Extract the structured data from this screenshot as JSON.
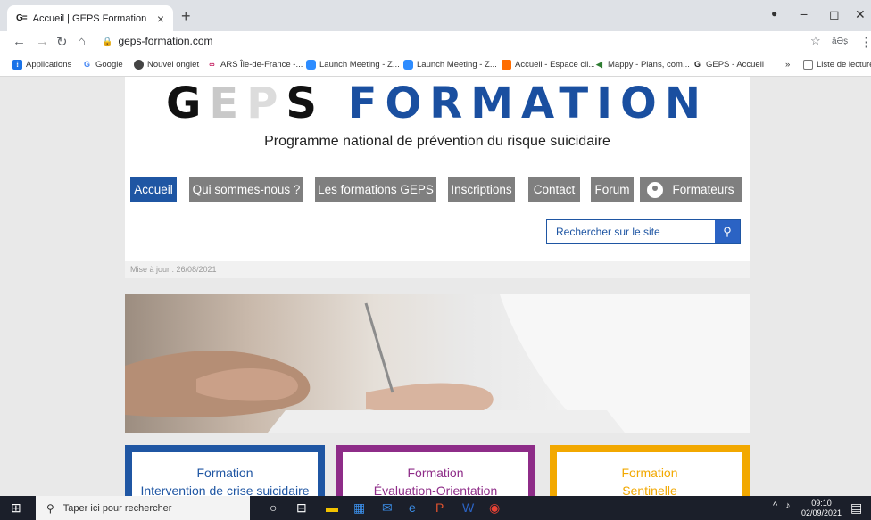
{
  "browser": {
    "tab_favicon": "G=",
    "tab_title": "Accueil | GEPS Formation",
    "tab_close": "×",
    "new_tab": "+",
    "url": "geps-formation.com",
    "window_controls": [
      "−",
      "◻",
      "✕"
    ],
    "profile_label": "āƏȿ"
  },
  "bookmarks": {
    "items": [
      {
        "label": "Applications",
        "icon": "apps-grid-icon",
        "color": "#1a73e8"
      },
      {
        "label": "Google",
        "icon": "google-icon",
        "color": "#4285f4"
      },
      {
        "label": "Nouvel onglet",
        "icon": "globe-icon",
        "color": "#444444"
      },
      {
        "label": "ARS Île-de-France -...",
        "icon": "ars-icon",
        "color": "#c2185b"
      },
      {
        "label": "Launch Meeting - Z...",
        "icon": "zoom-icon",
        "color": "#2d8cff"
      },
      {
        "label": "Launch Meeting - Z...",
        "icon": "zoom-icon",
        "color": "#2d8cff"
      },
      {
        "label": "Accueil - Espace cli...",
        "icon": "square-icon",
        "color": "#ff6d00"
      },
      {
        "label": "Mappy - Plans, com...",
        "icon": "mappy-icon",
        "color": "#2e7d32"
      },
      {
        "label": "GEPS - Accueil",
        "icon": "geps-icon",
        "color": "#222222"
      }
    ],
    "overflow": "»",
    "reading_list": "Liste de lecture"
  },
  "site": {
    "logo_parts": [
      "G",
      "E",
      "P",
      "S",
      " FORMATION"
    ],
    "tagline": "Programme national de prévention du risque suicidaire",
    "nav": [
      "Accueil",
      "Qui sommes-nous ?",
      "Les formations GEPS",
      "Inscriptions",
      "Contact",
      "Forum",
      "Formateurs"
    ],
    "search_placeholder": "Rechercher sur le site",
    "updated": "Mise à jour : 26/08/2021",
    "formations": [
      {
        "line1": "Formation",
        "line2": "Intervention de crise suicidaire",
        "color": "#1f56a3"
      },
      {
        "line1": "Formation",
        "line2": "Évaluation-Orientation",
        "color": "#8e2c88"
      },
      {
        "line1": "Formation",
        "line2": "Sentinelle",
        "color": "#f2a800"
      }
    ],
    "accent_color": "#1f56a3"
  },
  "taskbar": {
    "search_placeholder": "Taper ici pour rechercher",
    "time": "09:10",
    "date": "02/09/2021"
  }
}
